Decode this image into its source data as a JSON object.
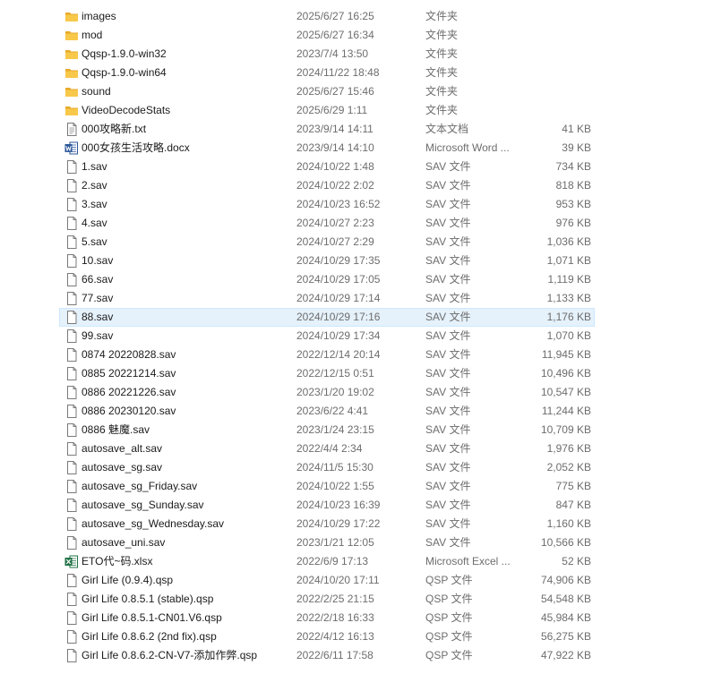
{
  "files": [
    {
      "name": "images",
      "date": "2025/6/27 16:25",
      "type": "文件夹",
      "size": "",
      "icon": "folder-icon",
      "selected": false
    },
    {
      "name": "mod",
      "date": "2025/6/27 16:34",
      "type": "文件夹",
      "size": "",
      "icon": "folder-icon",
      "selected": false
    },
    {
      "name": "Qqsp-1.9.0-win32",
      "date": "2023/7/4 13:50",
      "type": "文件夹",
      "size": "",
      "icon": "folder-icon",
      "selected": false
    },
    {
      "name": "Qqsp-1.9.0-win64",
      "date": "2024/11/22 18:48",
      "type": "文件夹",
      "size": "",
      "icon": "folder-icon",
      "selected": false
    },
    {
      "name": "sound",
      "date": "2025/6/27 15:46",
      "type": "文件夹",
      "size": "",
      "icon": "folder-icon",
      "selected": false
    },
    {
      "name": "VideoDecodeStats",
      "date": "2025/6/29 1:11",
      "type": "文件夹",
      "size": "",
      "icon": "folder-icon",
      "selected": false
    },
    {
      "name": "000攻略新.txt",
      "date": "2023/9/14 14:11",
      "type": "文本文档",
      "size": "41 KB",
      "icon": "text-file-icon",
      "selected": false
    },
    {
      "name": "000女孩生活攻略.docx",
      "date": "2023/9/14 14:10",
      "type": "Microsoft Word ...",
      "size": "39 KB",
      "icon": "word-file-icon",
      "selected": false
    },
    {
      "name": "1.sav",
      "date": "2024/10/22 1:48",
      "type": "SAV 文件",
      "size": "734 KB",
      "icon": "file-icon",
      "selected": false
    },
    {
      "name": "2.sav",
      "date": "2024/10/22 2:02",
      "type": "SAV 文件",
      "size": "818 KB",
      "icon": "file-icon",
      "selected": false
    },
    {
      "name": "3.sav",
      "date": "2024/10/23 16:52",
      "type": "SAV 文件",
      "size": "953 KB",
      "icon": "file-icon",
      "selected": false
    },
    {
      "name": "4.sav",
      "date": "2024/10/27 2:23",
      "type": "SAV 文件",
      "size": "976 KB",
      "icon": "file-icon",
      "selected": false
    },
    {
      "name": "5.sav",
      "date": "2024/10/27 2:29",
      "type": "SAV 文件",
      "size": "1,036 KB",
      "icon": "file-icon",
      "selected": false
    },
    {
      "name": "10.sav",
      "date": "2024/10/29 17:35",
      "type": "SAV 文件",
      "size": "1,071 KB",
      "icon": "file-icon",
      "selected": false
    },
    {
      "name": "66.sav",
      "date": "2024/10/29 17:05",
      "type": "SAV 文件",
      "size": "1,119 KB",
      "icon": "file-icon",
      "selected": false
    },
    {
      "name": "77.sav",
      "date": "2024/10/29 17:14",
      "type": "SAV 文件",
      "size": "1,133 KB",
      "icon": "file-icon",
      "selected": false
    },
    {
      "name": "88.sav",
      "date": "2024/10/29 17:16",
      "type": "SAV 文件",
      "size": "1,176 KB",
      "icon": "file-icon",
      "selected": true
    },
    {
      "name": "99.sav",
      "date": "2024/10/29 17:34",
      "type": "SAV 文件",
      "size": "1,070 KB",
      "icon": "file-icon",
      "selected": false
    },
    {
      "name": "0874 20220828.sav",
      "date": "2022/12/14 20:14",
      "type": "SAV 文件",
      "size": "11,945 KB",
      "icon": "file-icon",
      "selected": false
    },
    {
      "name": "0885 20221214.sav",
      "date": "2022/12/15 0:51",
      "type": "SAV 文件",
      "size": "10,496 KB",
      "icon": "file-icon",
      "selected": false
    },
    {
      "name": "0886 20221226.sav",
      "date": "2023/1/20 19:02",
      "type": "SAV 文件",
      "size": "10,547 KB",
      "icon": "file-icon",
      "selected": false
    },
    {
      "name": "0886 20230120.sav",
      "date": "2023/6/22 4:41",
      "type": "SAV 文件",
      "size": "11,244 KB",
      "icon": "file-icon",
      "selected": false
    },
    {
      "name": "0886 魅魔.sav",
      "date": "2023/1/24 23:15",
      "type": "SAV 文件",
      "size": "10,709 KB",
      "icon": "file-icon",
      "selected": false
    },
    {
      "name": "autosave_alt.sav",
      "date": "2022/4/4 2:34",
      "type": "SAV 文件",
      "size": "1,976 KB",
      "icon": "file-icon",
      "selected": false
    },
    {
      "name": "autosave_sg.sav",
      "date": "2024/11/5 15:30",
      "type": "SAV 文件",
      "size": "2,052 KB",
      "icon": "file-icon",
      "selected": false
    },
    {
      "name": "autosave_sg_Friday.sav",
      "date": "2024/10/22 1:55",
      "type": "SAV 文件",
      "size": "775 KB",
      "icon": "file-icon",
      "selected": false
    },
    {
      "name": "autosave_sg_Sunday.sav",
      "date": "2024/10/23 16:39",
      "type": "SAV 文件",
      "size": "847 KB",
      "icon": "file-icon",
      "selected": false
    },
    {
      "name": "autosave_sg_Wednesday.sav",
      "date": "2024/10/29 17:22",
      "type": "SAV 文件",
      "size": "1,160 KB",
      "icon": "file-icon",
      "selected": false
    },
    {
      "name": "autosave_uni.sav",
      "date": "2023/1/21 12:05",
      "type": "SAV 文件",
      "size": "10,566 KB",
      "icon": "file-icon",
      "selected": false
    },
    {
      "name": "ETO代~码.xlsx",
      "date": "2022/6/9 17:13",
      "type": "Microsoft Excel ...",
      "size": "52 KB",
      "icon": "excel-file-icon",
      "selected": false
    },
    {
      "name": "Girl Life (0.9.4).qsp",
      "date": "2024/10/20 17:11",
      "type": "QSP 文件",
      "size": "74,906 KB",
      "icon": "file-icon",
      "selected": false
    },
    {
      "name": "Girl Life 0.8.5.1 (stable).qsp",
      "date": "2022/2/25 21:15",
      "type": "QSP 文件",
      "size": "54,548 KB",
      "icon": "file-icon",
      "selected": false
    },
    {
      "name": "Girl Life 0.8.5.1-CN01.V6.qsp",
      "date": "2022/2/18 16:33",
      "type": "QSP 文件",
      "size": "45,984 KB",
      "icon": "file-icon",
      "selected": false
    },
    {
      "name": "Girl Life 0.8.6.2 (2nd fix).qsp",
      "date": "2022/4/12 16:13",
      "type": "QSP 文件",
      "size": "56,275 KB",
      "icon": "file-icon",
      "selected": false
    },
    {
      "name": "Girl Life 0.8.6.2-CN-V7-添加作弊.qsp",
      "date": "2022/6/11 17:58",
      "type": "QSP 文件",
      "size": "47,922 KB",
      "icon": "file-icon",
      "selected": false
    }
  ],
  "colors": {
    "selected_bg": "#e5f1fb",
    "folder": "#f8c84a",
    "word": "#2b579a",
    "excel": "#217346"
  }
}
